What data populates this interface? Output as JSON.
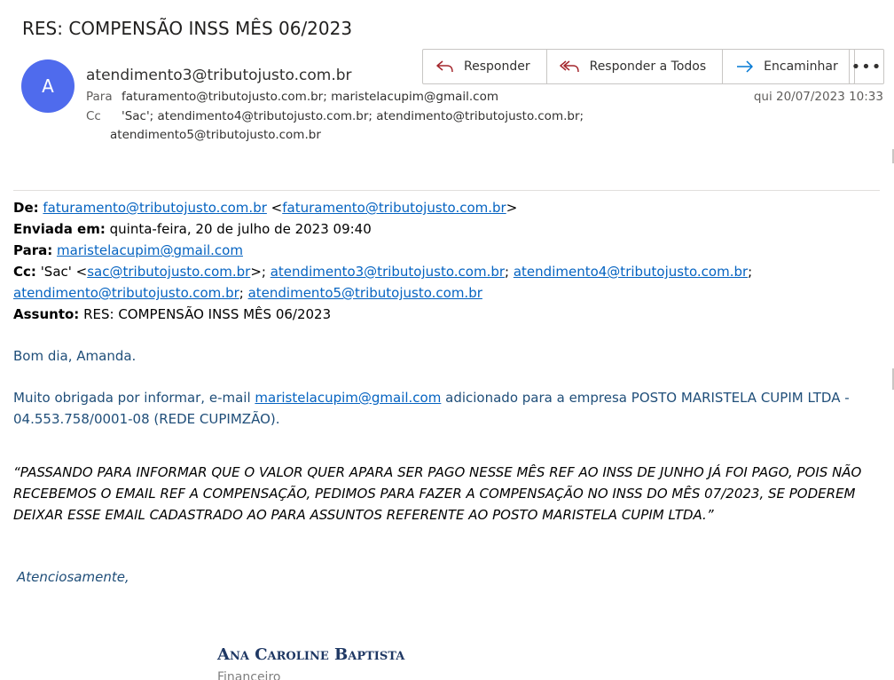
{
  "subject": "RES: COMPENSÃO INSS MÊS 06/2023",
  "avatar_initial": "A",
  "sender": "atendimento3@tributojusto.com.br",
  "to_label": "Para",
  "to_value": "faturamento@tributojusto.com.br; maristelacupim@gmail.com",
  "cc_label": "Cc",
  "cc_value_1": "'Sac'; atendimento4@tributojusto.com.br; atendimento@tributojusto.com.br;",
  "cc_value_2": "atendimento5@tributojusto.com.br",
  "date": "qui 20/07/2023 10:33",
  "toolbar": {
    "reply": "Responder",
    "reply_all": "Responder a Todos",
    "forward": "Encaminhar",
    "more": "•••"
  },
  "forwarded": {
    "from_label": "De:",
    "from_link": "faturamento@tributojusto.com.br",
    "from_bracket_link": "faturamento@tributojusto.com.br",
    "sent_label": "Enviada em:",
    "sent_value": "quinta-feira, 20 de julho de 2023 09:40",
    "to_label": "Para:",
    "to_link": "maristelacupim@gmail.com",
    "cc_label": "Cc:",
    "cc_sac": "'Sac' <",
    "cc_link_sac": "sac@tributojusto.com.br",
    "cc_link_3": "atendimento3@tributojusto.com.br",
    "cc_link_4": "atendimento4@tributojusto.com.br",
    "cc_link_base": "atendimento@tributojusto.com.br",
    "cc_link_5": "atendimento5@tributojusto.com.br",
    "subject_label": "Assunto:",
    "subject_value": "RES: COMPENSÃO INSS MÊS 06/2023"
  },
  "greeting": "Bom dia, Amanda.",
  "para1_start": "Muito obrigada por informar, e-mail ",
  "para1_link": "maristelacupim@gmail.com",
  "para1_end": "  adicionado para a empresa POSTO MARISTELA CUPIM LTDA - 04.553.758/0001-08 (REDE CUPIMZÃO).",
  "quote": "“PASSANDO PARA INFORMAR QUE O VALOR QUER APARA SER PAGO NESSE MÊS REF AO INSS DE JUNHO JÁ FOI PAGO, POIS NÃO RECEBEMOS O EMAIL REF A COMPENSAÇÃO, PEDIMOS PARA FAZER A COMPENSAÇÃO NO INSS DO MÊS 07/2023, SE PODEREM DEIXAR ESSE EMAIL CADASTRADO AO PARA ASSUNTOS REFERENTE AO POSTO MARISTELA CUPIM LTDA.”",
  "signoff": "Atenciosamente,",
  "signature_name": "Ana Caroline Baptista",
  "signature_role": "Financeiro",
  "colors": {
    "avatar": "#4f6bed",
    "link": "#0563c1",
    "body_blue": "#1f4e79",
    "signature": "#1f3864",
    "icon_accent": "#0078d4",
    "reply_icon": "#a4262c"
  },
  "icons": {
    "reply": "reply-icon",
    "reply_all": "reply-all-icon",
    "forward": "forward-arrow-icon"
  }
}
